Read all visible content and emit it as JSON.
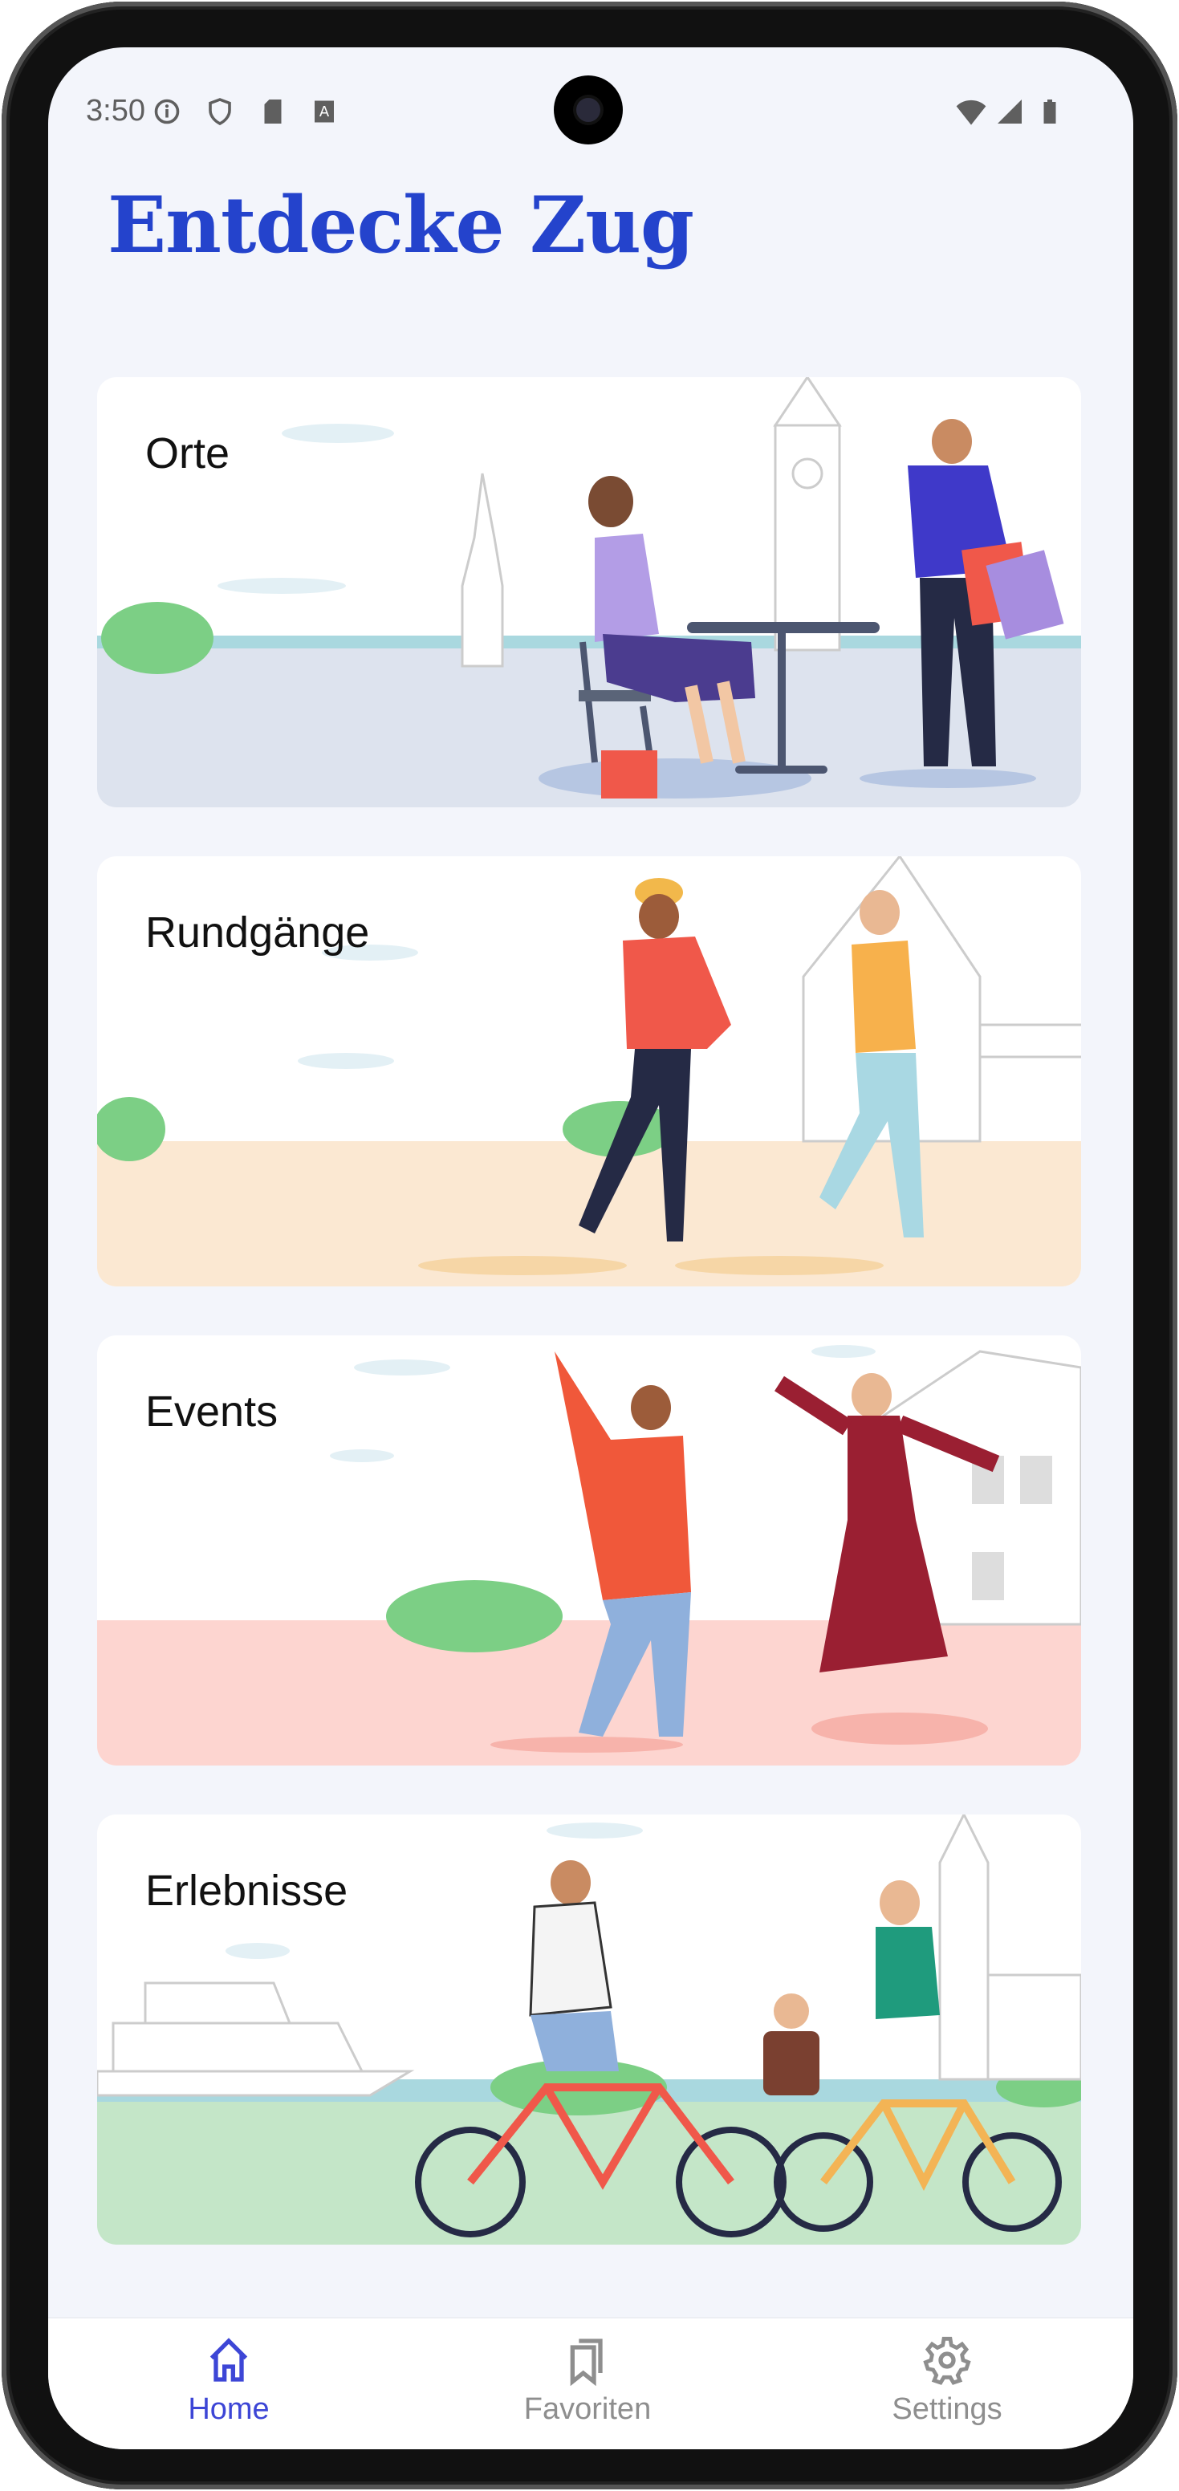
{
  "status_bar": {
    "time": "3:50",
    "left_icons": [
      "info-icon",
      "shield-icon",
      "sd-card-icon",
      "a-icon"
    ],
    "right_icons": [
      "wifi-icon",
      "signal-icon",
      "battery-icon"
    ]
  },
  "header": {
    "title": "Entdecke Zug"
  },
  "cards": [
    {
      "label": "Orte",
      "ground": "#dde3ee"
    },
    {
      "label": "Rundgänge",
      "ground": "#fbe8d2"
    },
    {
      "label": "Events",
      "ground": "#fdd5d0"
    },
    {
      "label": "Erlebnisse",
      "ground": "#c4e6c8"
    }
  ],
  "nav": {
    "items": [
      {
        "label": "Home",
        "icon": "home-icon",
        "active": true
      },
      {
        "label": "Favoriten",
        "icon": "bookmarks-icon",
        "active": false
      },
      {
        "label": "Settings",
        "icon": "gear-icon",
        "active": false
      }
    ],
    "active_color": "#3d46d6",
    "inactive_color": "#8e8e8e"
  },
  "colors": {
    "accent": "#2443cc",
    "background": "#f3f5fb"
  }
}
